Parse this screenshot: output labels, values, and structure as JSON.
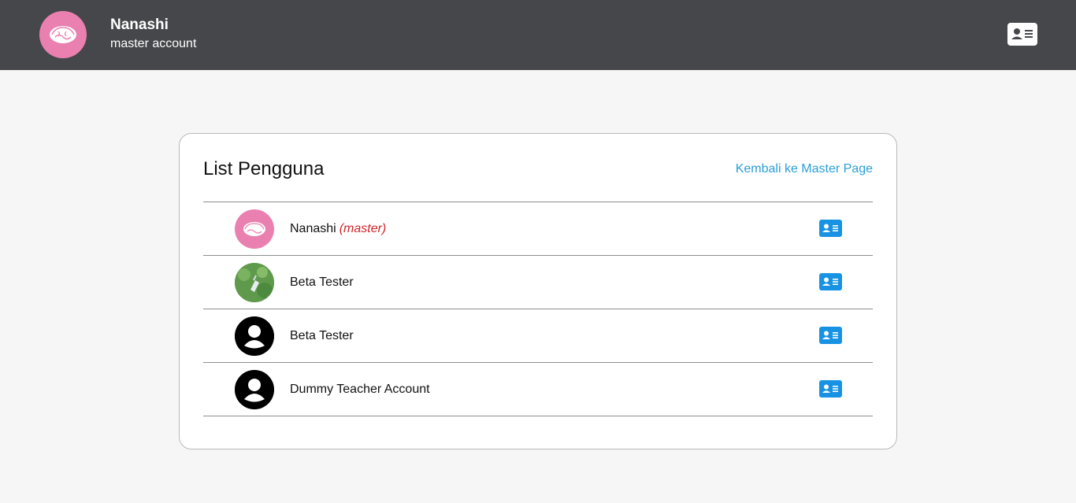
{
  "header": {
    "user_name": "Nanashi",
    "user_role": "master account",
    "avatar_icon": "brain-doodle-avatar",
    "profile_button_icon": "contact-card-icon",
    "background_color": "#46474b"
  },
  "card": {
    "title": "List Pengguna",
    "back_link": "Kembali ke Master Page",
    "link_color": "#2a9fd8"
  },
  "users": [
    {
      "name": "Nanashi",
      "tag": "(master)",
      "avatar": "brain-doodle-avatar",
      "action_icon": "contact-card-icon"
    },
    {
      "name": "Beta Tester",
      "tag": "",
      "avatar": "grass-photo-avatar",
      "action_icon": "contact-card-icon"
    },
    {
      "name": "Beta Tester",
      "tag": "",
      "avatar": "default-user-avatar",
      "action_icon": "contact-card-icon"
    },
    {
      "name": "Dummy Teacher Account",
      "tag": "",
      "avatar": "default-user-avatar",
      "action_icon": "contact-card-icon"
    }
  ],
  "colors": {
    "accent_blue": "#1893e3",
    "master_tag_red": "#d0262a",
    "avatar_pink": "#ea80b0"
  }
}
